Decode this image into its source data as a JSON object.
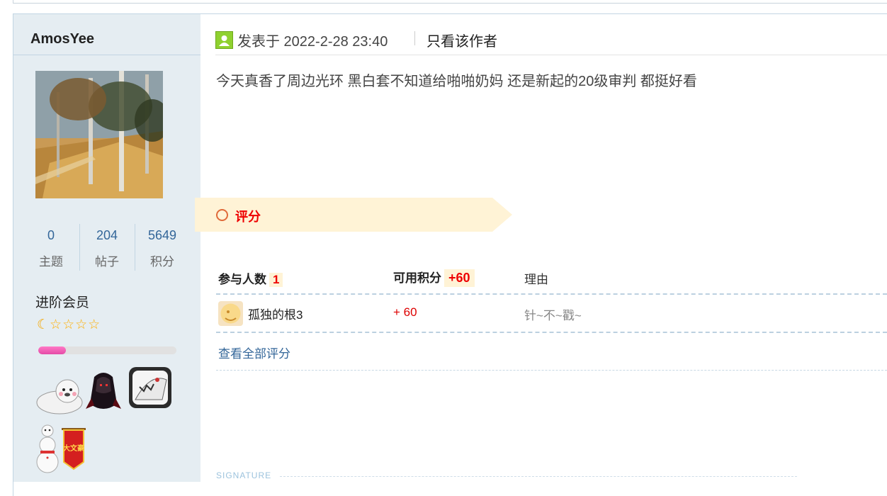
{
  "user": {
    "username": "AmosYee",
    "stats": [
      {
        "value": "0",
        "label": "主题"
      },
      {
        "value": "204",
        "label": "帖子"
      },
      {
        "value": "5649",
        "label": "积分"
      }
    ],
    "member_level": "进阶会员",
    "stars": "☆☆☆☆",
    "level_progress": 0.2
  },
  "post": {
    "posted_at": "发表于 2022-2-28 23:40",
    "only_author": "只看该作者",
    "content": "今天真香了周边光环 黑白套不知道给啪啪奶妈 还是新起的20级审判 都挺好看"
  },
  "rating": {
    "title": "评分",
    "participants_label": "参与人数",
    "participants_count": "1",
    "points_label": "可用积分",
    "points_total": "+60",
    "reason_label": "理由",
    "rows": [
      {
        "name": "孤独的根3",
        "score": "+ 60",
        "reason": "针~不~戳~"
      }
    ],
    "view_all": "查看全部评分"
  },
  "signature_label": "SIGNATURE",
  "colors": {
    "sidebar_bg": "#e5edf2",
    "accent_red": "#dd0000",
    "link_blue": "#336699",
    "rate_banner": "#fff3d6"
  }
}
